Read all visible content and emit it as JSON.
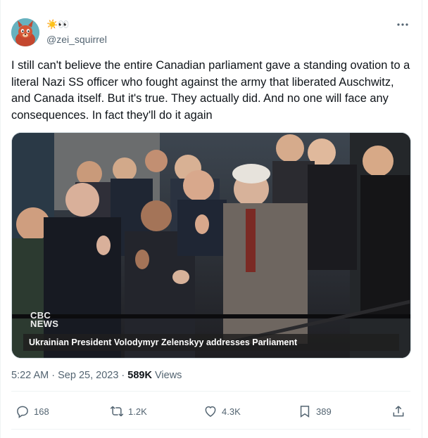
{
  "user": {
    "display_name": "☀️👀",
    "handle": "@zei_squirrel"
  },
  "tweet": {
    "text": "I still can't believe the entire Canadian parliament gave a standing ovation to a literal Nazi SS officer who fought against the army that liberated Auschwitz, and Canada itself. But it's true. They actually did. And no one will face any consequences. In fact they'll do it again",
    "media": {
      "logo_text_1": "CBC",
      "logo_text_2": "NEWS",
      "caption": "Ukrainian President Volodymyr Zelenskyy addresses Parliament"
    },
    "time": "5:22 AM",
    "date": "Sep 25, 2023",
    "views_count": "589K",
    "views_label": "Views"
  },
  "actions": {
    "replies": "168",
    "reposts": "1.2K",
    "likes": "4.3K",
    "bookmarks": "389"
  },
  "icons": {
    "more": "more-dots-icon",
    "reply": "reply-icon",
    "repost": "repost-icon",
    "like": "heart-icon",
    "bookmark": "bookmark-icon",
    "share": "share-icon"
  }
}
